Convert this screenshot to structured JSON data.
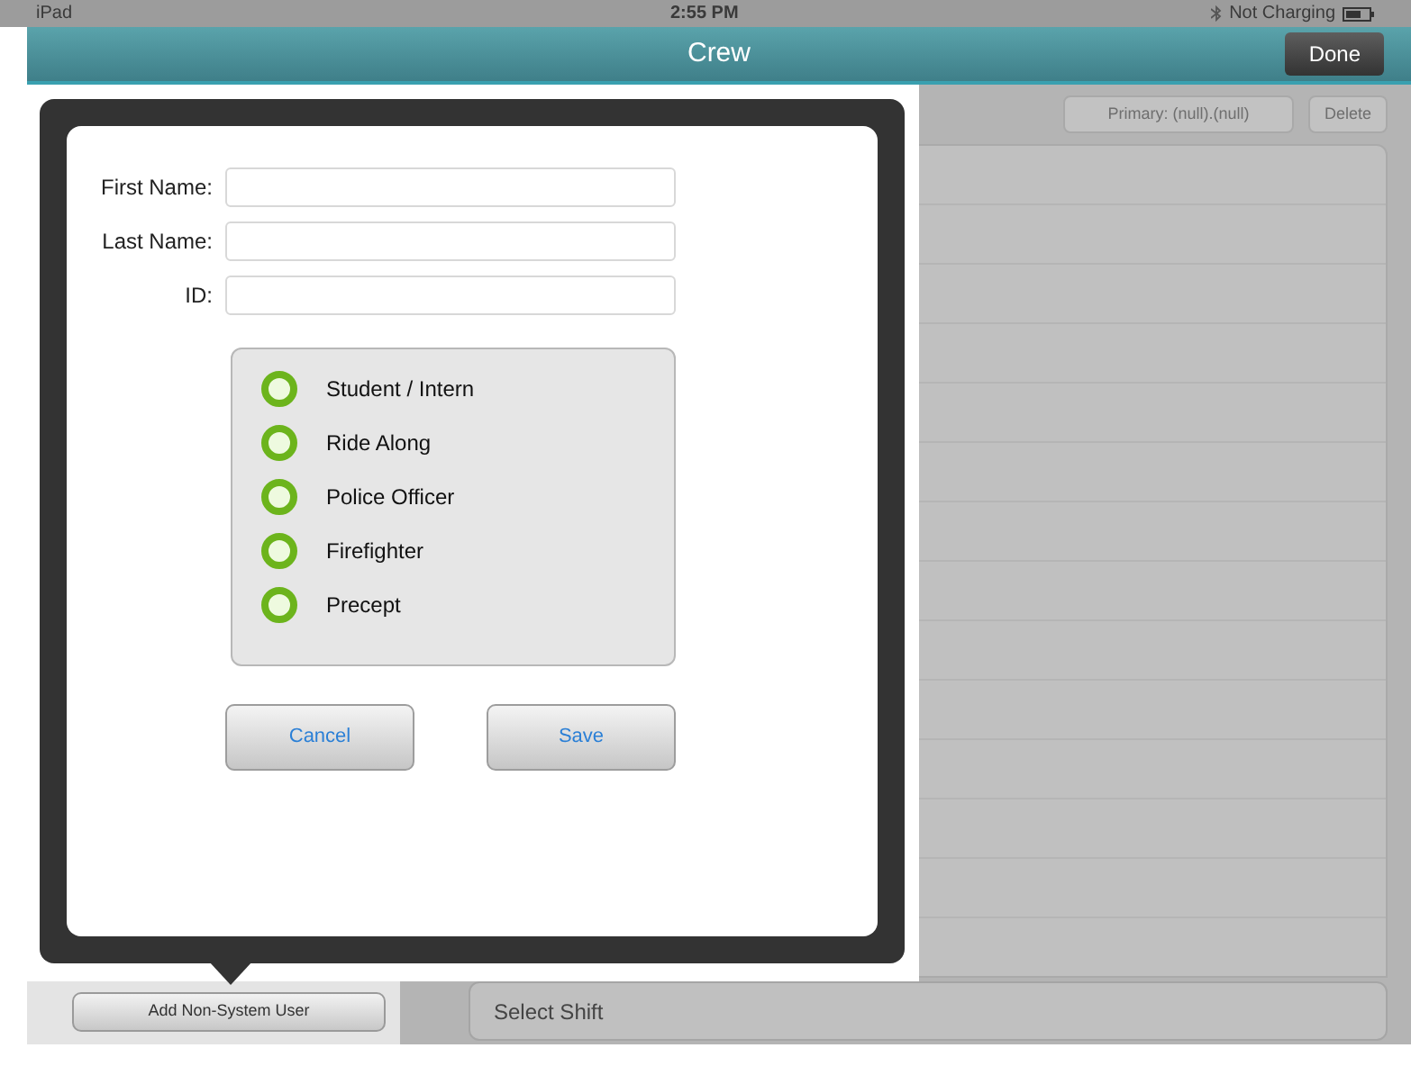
{
  "status_bar": {
    "device": "iPad",
    "time": "2:55 PM",
    "battery": "Not Charging"
  },
  "nav_bar": {
    "title": "Crew",
    "done_button": "Done"
  },
  "toolbar": {
    "primary_button": "Primary: (null).(null)",
    "delete_button": "Delete"
  },
  "form": {
    "fields": [
      {
        "label": "First Name:"
      },
      {
        "label": "Last Name:"
      },
      {
        "label": "ID:"
      }
    ],
    "roles": [
      {
        "label": "Student / Intern",
        "selected": false
      },
      {
        "label": "Ride Along",
        "selected": false
      },
      {
        "label": "Police Officer",
        "selected": false
      },
      {
        "label": "Firefighter",
        "selected": false
      },
      {
        "label": "Precept",
        "selected": false
      }
    ],
    "buttons": [
      "Cancel",
      "Save"
    ]
  },
  "add_user_button": "Add Non-System User",
  "shift_field": {
    "value": "Select Shift"
  }
}
